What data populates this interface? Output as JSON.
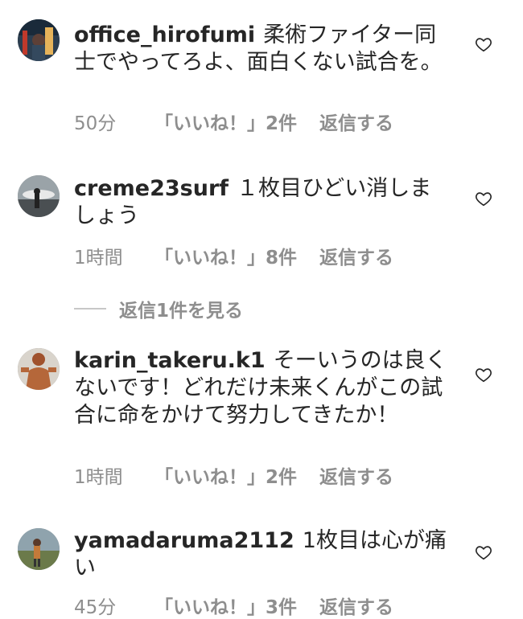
{
  "comments": [
    {
      "username": "office_hirofumi",
      "text": "柔術ファイター同士でやってろよ、面白くない試合を。",
      "time": "50分",
      "likes": "「いいね！」2件",
      "reply": "返信する",
      "avatar": "city-night-photo"
    },
    {
      "username": "creme23surf",
      "text": "１枚目ひどい消しましょう",
      "time": "1時間",
      "likes": "「いいね！」8件",
      "reply": "返信する",
      "avatar": "surfer-photo"
    },
    {
      "username": "karin_takeru.k1",
      "text": "そーいうのは良くないです！どれだけ未来くんがこの試合に命をかけて努力してきたか！",
      "time": "1時間",
      "likes": "「いいね！」2件",
      "reply": "返信する",
      "avatar": "fighter-photo"
    },
    {
      "username": "yamadaruma2112",
      "text": "1枚目は心が痛い",
      "time": "45分",
      "likes": "「いいね！」3件",
      "reply": "返信する",
      "avatar": "landscape-photo"
    }
  ],
  "view_replies": "返信1件を見る",
  "icons": {
    "like": "heart-icon"
  },
  "colors": {
    "text": "#262626",
    "muted": "#8e8e8e",
    "divider": "#c7c7c7"
  }
}
